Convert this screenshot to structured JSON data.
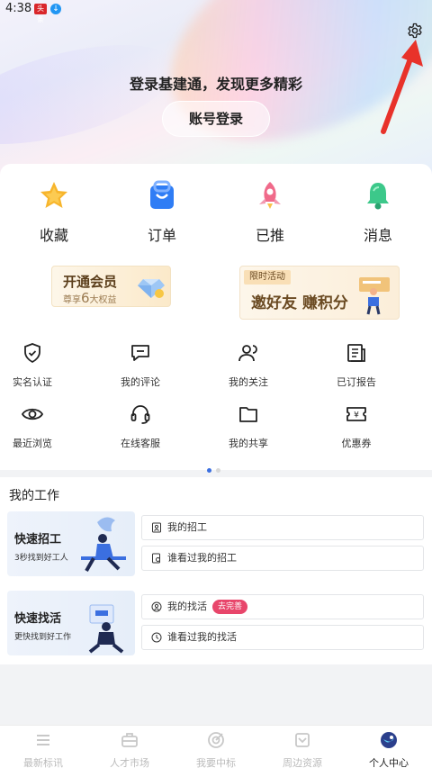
{
  "status_bar": {
    "time": "4:38",
    "badge1": "头条",
    "badge2": "↓"
  },
  "header": {
    "title": "登录基建通，发现更多精彩",
    "login_button": "账号登录"
  },
  "quick_actions": [
    {
      "label": "收藏",
      "icon": "star-icon"
    },
    {
      "label": "订单",
      "icon": "bag-icon"
    },
    {
      "label": "已推",
      "icon": "rocket-icon"
    },
    {
      "label": "消息",
      "icon": "bell-icon"
    }
  ],
  "vip_banner": {
    "title": "开通会员",
    "prefix": "尊享",
    "number": "6",
    "suffix": "大权益"
  },
  "invite_banner": {
    "tag": "限时活动",
    "title": "邀好友 赚积分"
  },
  "grid": [
    {
      "label": "实名认证",
      "icon": "shield-icon"
    },
    {
      "label": "我的评论",
      "icon": "comment-icon"
    },
    {
      "label": "我的关注",
      "icon": "follow-icon"
    },
    {
      "label": "已订报告",
      "icon": "report-icon"
    },
    {
      "label": "最近浏览",
      "icon": "eye-icon"
    },
    {
      "label": "在线客服",
      "icon": "headset-icon"
    },
    {
      "label": "我的共享",
      "icon": "folder-icon"
    },
    {
      "label": "优惠券",
      "icon": "coupon-icon"
    }
  ],
  "my_work": {
    "heading": "我的工作",
    "hire": {
      "title": "快速招工",
      "subtitle": "3秒找到好工人",
      "rows": [
        "我的招工",
        "谁看过我的招工"
      ]
    },
    "job": {
      "title": "快速找活",
      "subtitle": "更快找到好工作",
      "rows": [
        "我的找活",
        "谁看过我的找活"
      ],
      "pill": "去完善"
    }
  },
  "tabbar": [
    {
      "label": "最新标讯",
      "icon": "list-icon",
      "active": false
    },
    {
      "label": "人才市场",
      "icon": "briefcase-icon",
      "active": false
    },
    {
      "label": "我要中标",
      "icon": "target-icon",
      "active": false
    },
    {
      "label": "周边资源",
      "icon": "map-icon",
      "active": false
    },
    {
      "label": "个人中心",
      "icon": "profile-icon",
      "active": true
    }
  ],
  "colors": {
    "accent": "#e8466b",
    "arrow": "#e8322a",
    "active_dot": "#3b6fe0"
  }
}
